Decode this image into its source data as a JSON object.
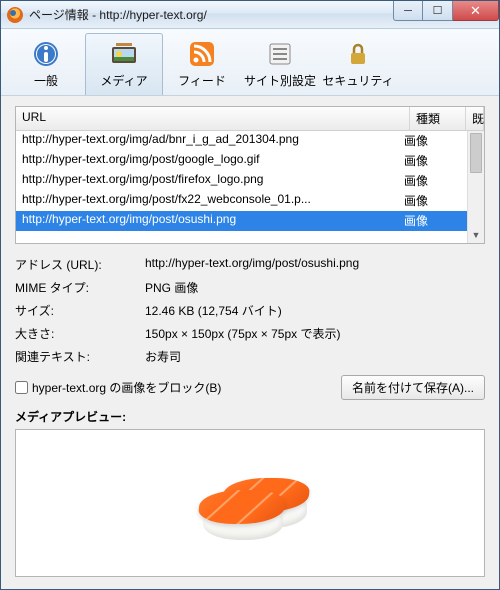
{
  "window": {
    "title": "ページ情報 - http://hyper-text.org/"
  },
  "tabs": {
    "general": "一般",
    "media": "メディア",
    "feed": "フィード",
    "permissions": "サイト別設定",
    "security": "セキュリティ"
  },
  "list": {
    "header": {
      "url": "URL",
      "type": "種類",
      "extra": "既"
    },
    "rows": [
      {
        "url": "http://hyper-text.org/img/ad/bnr_i_g_ad_201304.png",
        "type": "画像"
      },
      {
        "url": "http://hyper-text.org/img/post/google_logo.gif",
        "type": "画像"
      },
      {
        "url": "http://hyper-text.org/img/post/firefox_logo.png",
        "type": "画像"
      },
      {
        "url": "http://hyper-text.org/img/post/fx22_webconsole_01.p...",
        "type": "画像"
      },
      {
        "url": "http://hyper-text.org/img/post/osushi.png",
        "type": "画像"
      }
    ]
  },
  "details": {
    "address_label": "アドレス (URL):",
    "address_value": "http://hyper-text.org/img/post/osushi.png",
    "mime_label": "MIME タイプ:",
    "mime_value": "PNG 画像",
    "size_label": "サイズ:",
    "size_value": "12.46 KB (12,754 バイト)",
    "dimensions_label": "大きさ:",
    "dimensions_value": "150px × 150px (75px × 75px で表示)",
    "alt_label": "関連テキスト:",
    "alt_value": "お寿司"
  },
  "block": {
    "label": "hyper-text.org の画像をブロック(B)"
  },
  "saveas": {
    "label": "名前を付けて保存(A)..."
  },
  "preview": {
    "label": "メディアプレビュー:"
  }
}
